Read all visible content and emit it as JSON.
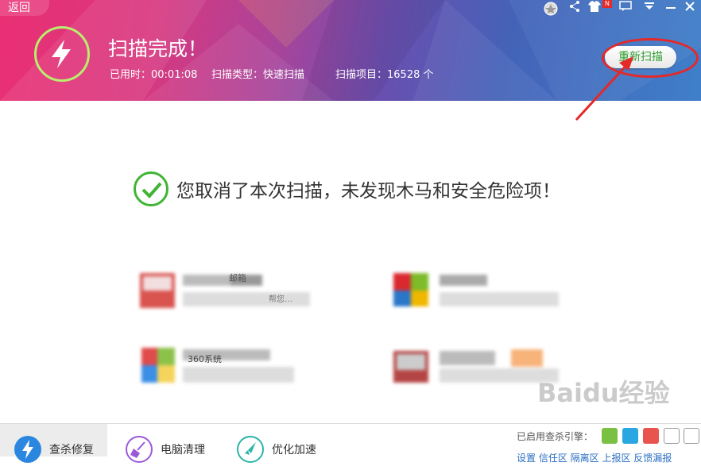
{
  "header": {
    "back_label": "返回",
    "title": "扫描完成！",
    "stats": {
      "elapsed": "已用时：00:01:08",
      "scan_type": "扫描类型：快速扫描",
      "items": "扫描项目：16528 个"
    },
    "rescan_label": "重新扫描",
    "badge": "N"
  },
  "result": {
    "message": "您取消了本次扫描，未发现木马和安全危险项！"
  },
  "promos": [
    {
      "label_partial": "邮箱",
      "desc_partial": "帮您…"
    },
    {
      "label_partial": "",
      "desc_partial": ""
    },
    {
      "label_partial": "360系统",
      "desc_partial": ""
    },
    {
      "label_partial": "",
      "desc_partial": ""
    }
  ],
  "bottom": {
    "tabs": [
      {
        "label": "查杀修复",
        "icon": "lightning-icon"
      },
      {
        "label": "电脑清理",
        "icon": "broom-icon"
      },
      {
        "label": "优化加速",
        "icon": "rocket-icon"
      }
    ],
    "engines_label": "已启用查杀引擎：",
    "settings_links": "设置  信任区  隔离区  上报区  反馈漏报"
  },
  "watermark": "Baidu经验",
  "colors": {
    "accent_green": "#3fb534",
    "annotation_red": "#e52828",
    "header_pink": "#ea2f74",
    "header_blue": "#3f7fc9"
  }
}
